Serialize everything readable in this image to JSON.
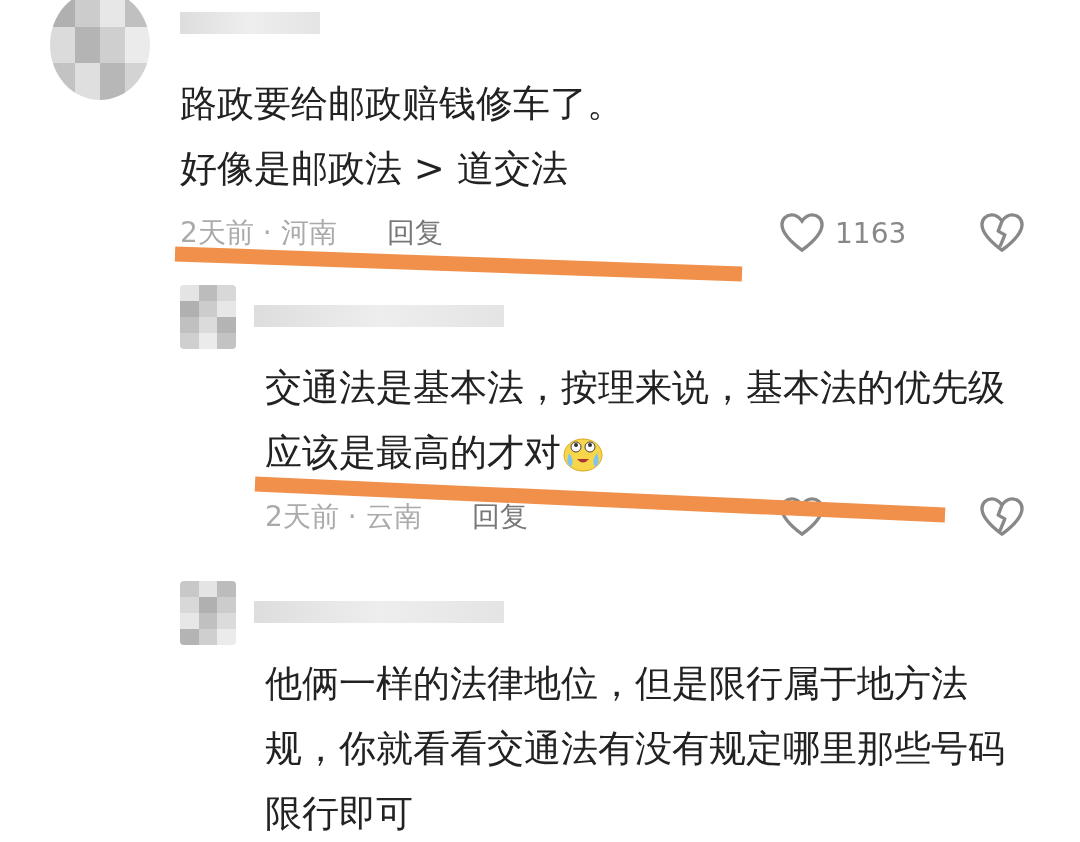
{
  "comments": [
    {
      "lines": [
        "路政要给邮政赔钱修车了。",
        "好像是邮政法 > 道交法"
      ],
      "emoji": false,
      "time_place": "2天前 · 河南",
      "reply_label": "回复",
      "like_count": "1163",
      "replies": [
        {
          "lines": [
            "交通法是基本法，按理来说，基本法的优先级",
            "应该是最高的才对"
          ],
          "emoji": true,
          "time_place": "2天前 · 云南",
          "reply_label": "回复"
        },
        {
          "lines": [
            "他俩一样的法律地位，但是限行属于地方法",
            "规，你就看看交通法有没有规定哪里那些号码",
            "限行即可"
          ],
          "emoji": false
        }
      ]
    }
  ]
}
